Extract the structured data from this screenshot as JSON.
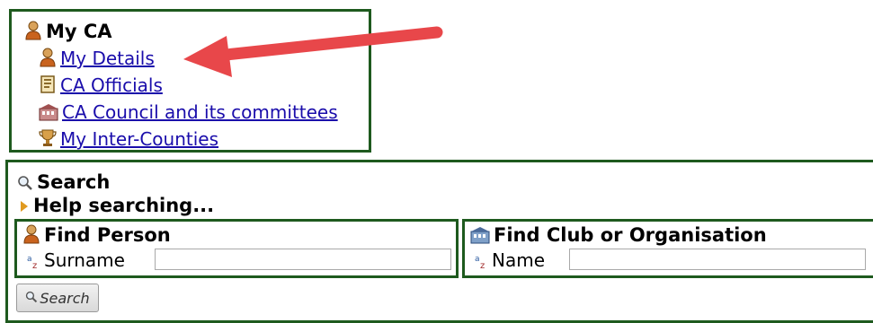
{
  "my_ca": {
    "title": "My CA",
    "links": [
      {
        "label": "My Details",
        "icon": "person-icon"
      },
      {
        "label": "CA Officials",
        "icon": "document-icon"
      },
      {
        "label": "CA Council and its committees",
        "icon": "building-icon"
      },
      {
        "label": "My Inter-Counties",
        "icon": "trophy-icon"
      }
    ]
  },
  "search": {
    "title": "Search",
    "help_label": "Help searching...",
    "find_person": {
      "title": "Find Person",
      "surname_label": "Surname",
      "surname_value": ""
    },
    "find_club": {
      "title": "Find Club or Organisation",
      "name_label": "Name",
      "name_value": ""
    },
    "button_label": "Search"
  },
  "colors": {
    "border": "#1e5a1e",
    "link": "#1a0dab",
    "arrow": "#e8474a"
  }
}
